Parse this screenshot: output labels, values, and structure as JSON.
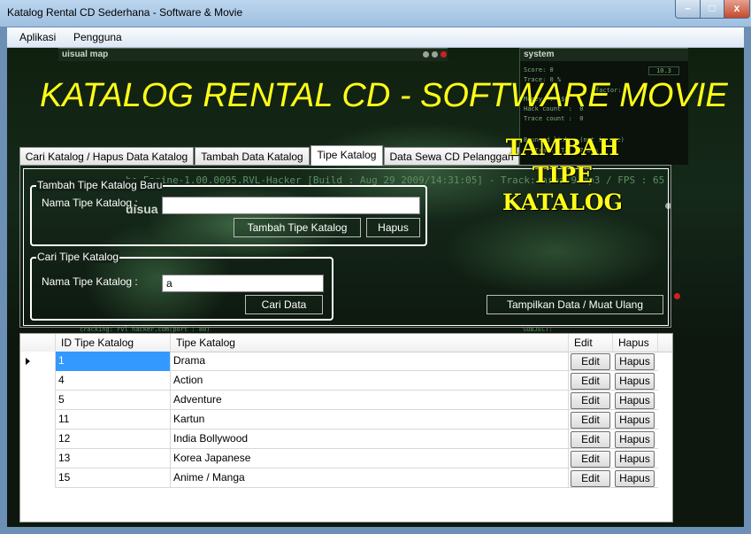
{
  "window": {
    "title": "Katalog Rental CD Sederhana - Software & Movie",
    "min_label": "",
    "max_label": "",
    "close_label": "x"
  },
  "menu": {
    "items": [
      "Aplikasi",
      "Pengguna"
    ]
  },
  "background": {
    "visual_map_label": "uisual map",
    "system_label": "system",
    "system_lines": [
      "Score: 0",
      "Trace: 0 %",
      "",
      "Money  :  $0",
      "Hack count  :  0",
      "Trace count :  0",
      "",
      "Bounced link : (not in use)",
      "   Trace ETA:  7:6 s"
    ],
    "factor_label": "factor:",
    "score_value": "10.3",
    "engine_line": "he Engine-1.00.0095.RVL-Hacker [Build : Aug 29 2009/14:31:05] - Track: area 9.mp3 / FPS : 65",
    "cracking_line": "cracking: rvl hacker.com(port : 80)",
    "subject_label": "SUBJECT:",
    "visual_stub": "uisua"
  },
  "banner": {
    "title": "KATALOG RENTAL CD - SOFTWARE  MOVIE"
  },
  "tabs": [
    {
      "label": "Cari Katalog / Hapus Data Katalog",
      "active": false
    },
    {
      "label": "Tambah Data Katalog",
      "active": false
    },
    {
      "label": "Tipe Katalog",
      "active": true
    },
    {
      "label": "Data Sewa CD Pelanggan",
      "active": false
    }
  ],
  "add_group": {
    "title": "Tambah Tipe Katalog Baru",
    "field_label": "Nama Tipe Katalog :",
    "field_value": "",
    "add_button": "Tambah Tipe Katalog",
    "delete_button": "Hapus"
  },
  "search_group": {
    "title": "Cari Tipe Katalog",
    "field_label": "Nama Tipe Katalog :",
    "field_value": "a",
    "search_button": "Cari Data"
  },
  "side_title": {
    "line1": "TAMBAH",
    "line2": "TIPE",
    "line3": "KATALOG"
  },
  "refresh_button": "Tampilkan Data / Muat Ulang",
  "grid": {
    "columns": [
      "ID Tipe Katalog",
      "Tipe Katalog",
      "Edit",
      "Hapus"
    ],
    "edit_label": "Edit",
    "delete_label": "Hapus",
    "rows": [
      {
        "id": "1",
        "tipe": "Drama"
      },
      {
        "id": "4",
        "tipe": "Action"
      },
      {
        "id": "5",
        "tipe": "Adventure"
      },
      {
        "id": "11",
        "tipe": "Kartun"
      },
      {
        "id": "12",
        "tipe": "India Bollywood"
      },
      {
        "id": "13",
        "tipe": "Korea Japanese"
      },
      {
        "id": "15",
        "tipe": "Anime / Manga"
      }
    ]
  }
}
